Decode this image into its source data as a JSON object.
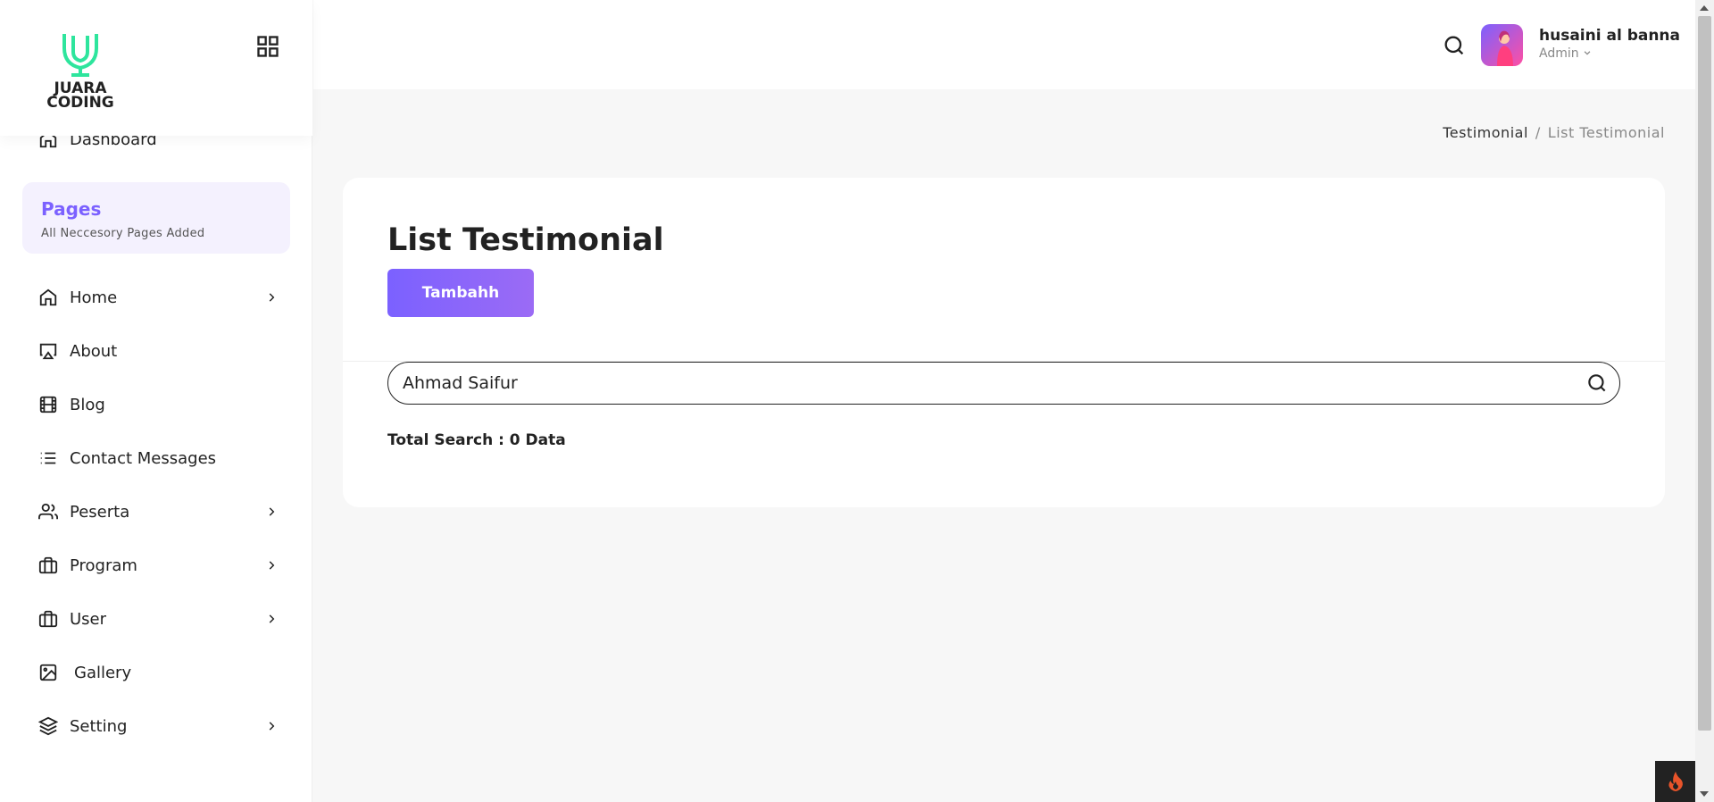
{
  "app": {
    "logo_text_1": "JUARA",
    "logo_text_2": "CODING",
    "brand_color": "#7b61ff",
    "logo_color": "#2ee59d"
  },
  "sidebar": {
    "dashboard_label": "Dashboard",
    "pages_card": {
      "title": "Pages",
      "subtitle": "All Neccesory Pages Added"
    },
    "items": [
      {
        "label": "Home",
        "icon": "home-icon",
        "has_chevron": true
      },
      {
        "label": "About",
        "icon": "airplay-icon",
        "has_chevron": false
      },
      {
        "label": "Blog",
        "icon": "film-icon",
        "has_chevron": false
      },
      {
        "label": "Contact Messages",
        "icon": "list-icon",
        "has_chevron": false
      },
      {
        "label": "Peserta",
        "icon": "users-icon",
        "has_chevron": true
      },
      {
        "label": "Program",
        "icon": "briefcase-icon",
        "has_chevron": true
      },
      {
        "label": "User",
        "icon": "briefcase-icon",
        "has_chevron": true
      },
      {
        "label": "Gallery",
        "icon": "image-icon",
        "has_chevron": false
      },
      {
        "label": "Setting",
        "icon": "layers-icon",
        "has_chevron": true
      }
    ]
  },
  "header": {
    "user_name": "husaini al banna",
    "user_role": "Admin"
  },
  "breadcrumb": {
    "parent": "Testimonial",
    "separator": "/",
    "current": "List Testimonial"
  },
  "main": {
    "title": "List Testimonial",
    "add_button_label": "Tambahh",
    "search_value": "Ahmad Saifur",
    "total_label": "Total Search : 0 Data"
  }
}
